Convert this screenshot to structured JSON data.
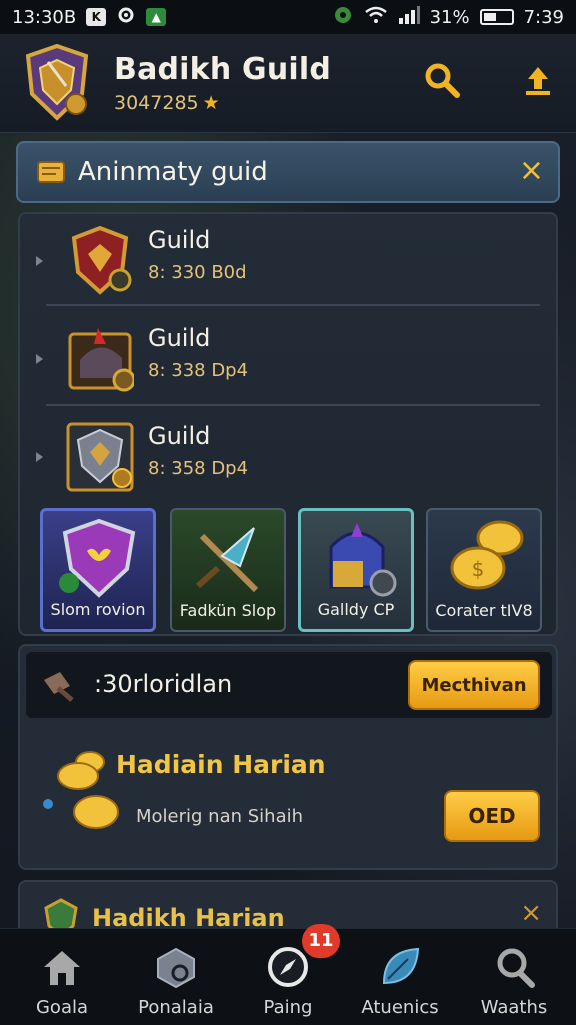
{
  "status_bar": {
    "time_left": "13:30B",
    "battery": "31%",
    "clock": "7:39",
    "left_icons": [
      "K",
      "settings-icon",
      "notification-icon"
    ],
    "right_icons": [
      "settings-gear-icon",
      "wifi-icon",
      "signal-icon",
      "battery-icon"
    ]
  },
  "header": {
    "title": "Badikh Guild",
    "subtitle": "3047285",
    "subtitle_icon": "star-icon",
    "actions": [
      "search-icon",
      "upload-icon"
    ]
  },
  "banner": {
    "title": "Aninmaty guid",
    "icon": "scroll-icon",
    "close": "×"
  },
  "guild_list": [
    {
      "name": "Guild",
      "value": "8: 330 B0d",
      "icon": "red-shield-icon"
    },
    {
      "name": "Guild",
      "value": "8: 338 Dp4",
      "icon": "treasure-chest-icon"
    },
    {
      "name": "Guild",
      "value": "8: 358 Dp4",
      "icon": "steel-shield-icon"
    }
  ],
  "cards": [
    {
      "label": "Slom rovion",
      "icon": "purple-shield-icon"
    },
    {
      "label": "Fadkün Slop",
      "icon": "crossed-weapons-icon"
    },
    {
      "label": "Galldy   CP",
      "icon": "helmet-icon"
    },
    {
      "label": "Corater tIV8",
      "icon": "gold-coins-icon"
    }
  ],
  "rewards": {
    "header_label": ":30rloridlan",
    "header_button": "Mecthivan",
    "title": "Hadiain Harian",
    "subtitle": "Molerig nan Sihaih",
    "button": "OED"
  },
  "peek_panel": {
    "title": "Hadikh Harian",
    "close": "×"
  },
  "bottom_nav": [
    {
      "label": "Goala",
      "icon": "home-icon"
    },
    {
      "label": "Ponalaia",
      "icon": "cube-icon"
    },
    {
      "label": "Paing",
      "icon": "compass-icon",
      "badge": "11"
    },
    {
      "label": "Atuenics",
      "icon": "leaf-icon"
    },
    {
      "label": "Waaths",
      "icon": "search-person-icon"
    }
  ],
  "colors": {
    "accent_gold": "#f0b323",
    "banner_blue": "#3a536a",
    "badge_red": "#e03a2a",
    "panel_bg": "#232c37"
  }
}
